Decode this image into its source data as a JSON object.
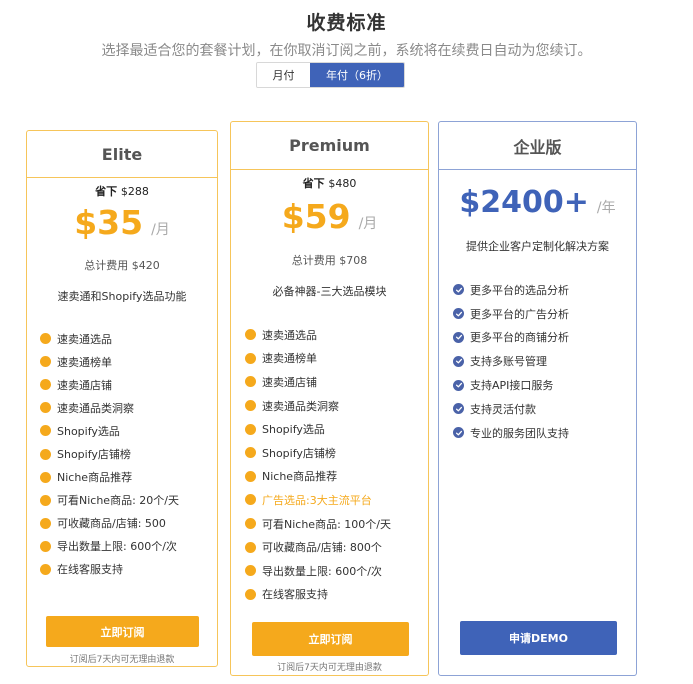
{
  "header": {
    "title": "收费标准",
    "subtitle": "选择最适合您的套餐计划，在你取消订阅之前，系统将在续费日自动为您续订。"
  },
  "billing_toggle": {
    "monthly": "月付",
    "yearly": "年付（6折）",
    "selected": "yearly"
  },
  "colors": {
    "accent": "#f5a91c",
    "brand": "#3f63b8"
  },
  "plans": {
    "elite": {
      "name": "Elite",
      "save_label": "省下",
      "save_amount": "$288",
      "price": "$35",
      "unit": "/月",
      "total": "总计费用 $420",
      "desc": "速卖通和Shopify选品功能",
      "features": [
        "速卖通选品",
        "速卖通榜单",
        "速卖通店铺",
        "速卖通品类洞察",
        "Shopify选品",
        "Shopify店铺榜",
        "Niche商品推荐",
        "可看Niche商品: 20个/天",
        "可收藏商品/店铺: 500",
        "导出数量上限: 600个/次",
        "在线客服支持"
      ],
      "button": "立即订阅",
      "note": "订阅后7天内可无理由退款"
    },
    "premium": {
      "name": "Premium",
      "save_label": "省下",
      "save_amount": "$480",
      "price": "$59",
      "unit": "/月",
      "total": "总计费用 $708",
      "desc": "必备神器-三大选品模块",
      "features": [
        "速卖通选品",
        "速卖通榜单",
        "速卖通店铺",
        "速卖通品类洞察",
        "Shopify选品",
        "Shopify店铺榜",
        "Niche商品推荐",
        "广告选品:3大主流平台",
        "可看Niche商品: 100个/天",
        "可收藏商品/店铺: 800个",
        "导出数量上限: 600个/次",
        "在线客服支持"
      ],
      "highlight_index": 7,
      "button": "立即订阅",
      "note": "订阅后7天内可无理由退款"
    },
    "enterprise": {
      "name": "企业版",
      "price": "$2400+",
      "unit": "/年",
      "desc": "提供企业客户定制化解决方案",
      "features": [
        "更多平台的选品分析",
        "更多平台的广告分析",
        "更多平台的商铺分析",
        "支持多账号管理",
        "支持API接口服务",
        "支持灵活付款",
        "专业的服务团队支持"
      ],
      "button": "申请DEMO"
    }
  }
}
